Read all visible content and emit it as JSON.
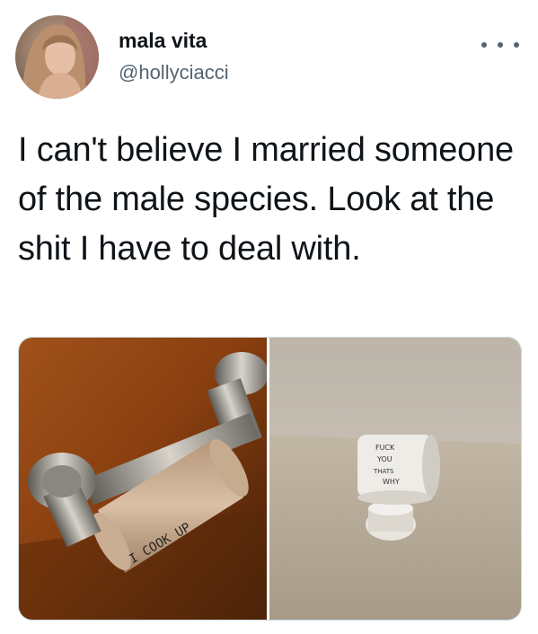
{
  "user": {
    "display_name": "mala vita",
    "handle": "@hollyciacci"
  },
  "tweet": {
    "text": "I can't believe I married someone of the male species. Look at the shit I have to deal with."
  },
  "media": {
    "left_photo_writing": "I COOK UP",
    "right_photo_writing": [
      "FUCK",
      "YOU",
      "THATS",
      "WHY"
    ]
  },
  "icons": {
    "more": "more-horizontal-icon"
  }
}
